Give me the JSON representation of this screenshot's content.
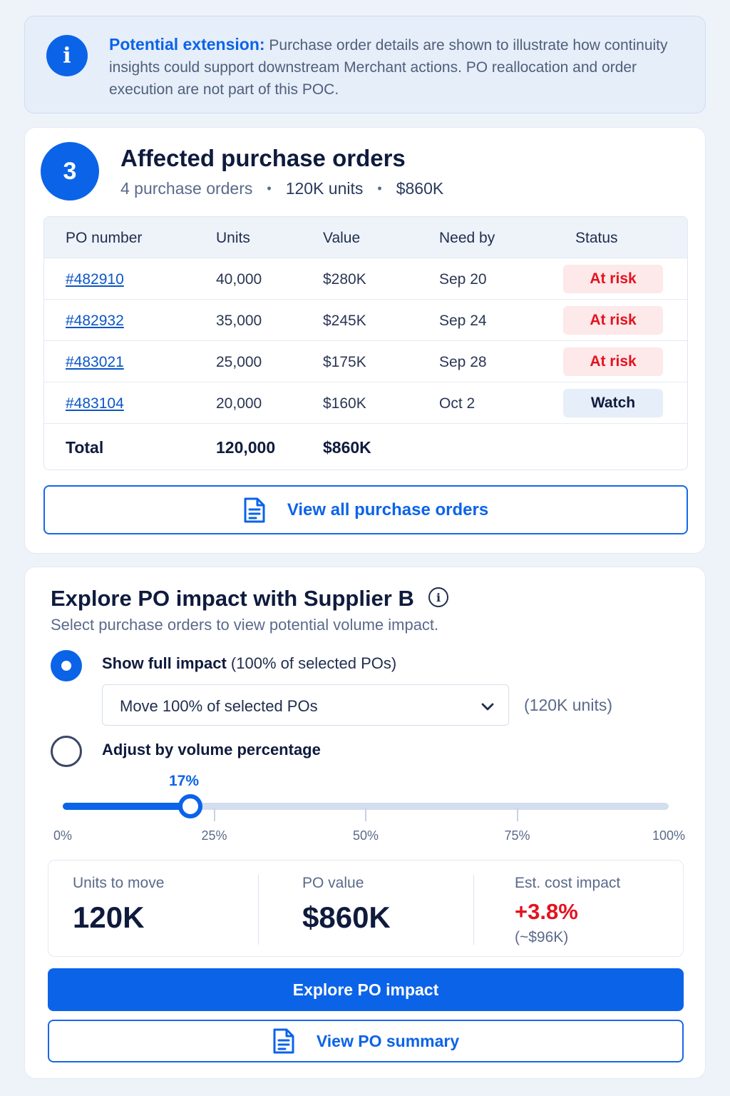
{
  "banner": {
    "icon": "info-icon",
    "title": "Potential extension:",
    "text": " Purchase order details are shown to illustrate how continuity insights could support downstream Merchant actions. PO reallocation and order execution are not part of this POC."
  },
  "orders": {
    "step": "3",
    "title": "Affected purchase orders",
    "summary": {
      "count": "4 purchase orders",
      "units": "120K units",
      "value": "$860K"
    },
    "columns": {
      "po": "PO number",
      "units": "Units",
      "value": "Value",
      "need_by": "Need by",
      "status": "Status"
    },
    "rows": [
      {
        "po": "#482910",
        "units": "40,000",
        "value": "$280K",
        "need_by": "Sep 20",
        "status": "At risk"
      },
      {
        "po": "#482932",
        "units": "35,000",
        "value": "$245K",
        "need_by": "Sep 24",
        "status": "At risk"
      },
      {
        "po": "#483021",
        "units": "25,000",
        "value": "$175K",
        "need_by": "Sep 28",
        "status": "At risk"
      },
      {
        "po": "#483104",
        "units": "20,000",
        "value": "$160K",
        "need_by": "Oct 2",
        "status": "Watch"
      }
    ],
    "total": {
      "label": "Total",
      "units": "120,000",
      "value": "$860K"
    },
    "view_all_label": "View all purchase orders"
  },
  "explore": {
    "title": "Explore PO impact with Supplier B",
    "subtitle": "Select purchase orders to view potential volume impact.",
    "option_full": {
      "bold": "Show full impact",
      "rest": " (100% of selected POs)",
      "selected": true
    },
    "select_value": "Move 100% of selected POs",
    "select_note": "(120K units)",
    "option_adjust": {
      "label": "Adjust by volume percentage",
      "selected": false
    },
    "slider": {
      "value_label": "17%",
      "value_fraction": 0.21,
      "ticks": [
        "0%",
        "25%",
        "50%",
        "75%",
        "100%"
      ]
    },
    "metrics": {
      "units_label": "Units to move",
      "units_value": "120K",
      "po_label": "PO value",
      "po_value": "$860K",
      "cost_label": "Est. cost impact",
      "cost_value": "+3.8%",
      "cost_note": "(~$96K)"
    },
    "primary_label": "Explore PO impact",
    "summary_label": "View PO summary"
  },
  "colors": {
    "accent": "#0b63e8",
    "risk": "#e3131f",
    "risk_bg": "#fde8ea",
    "watch_bg": "#e6eef9"
  }
}
